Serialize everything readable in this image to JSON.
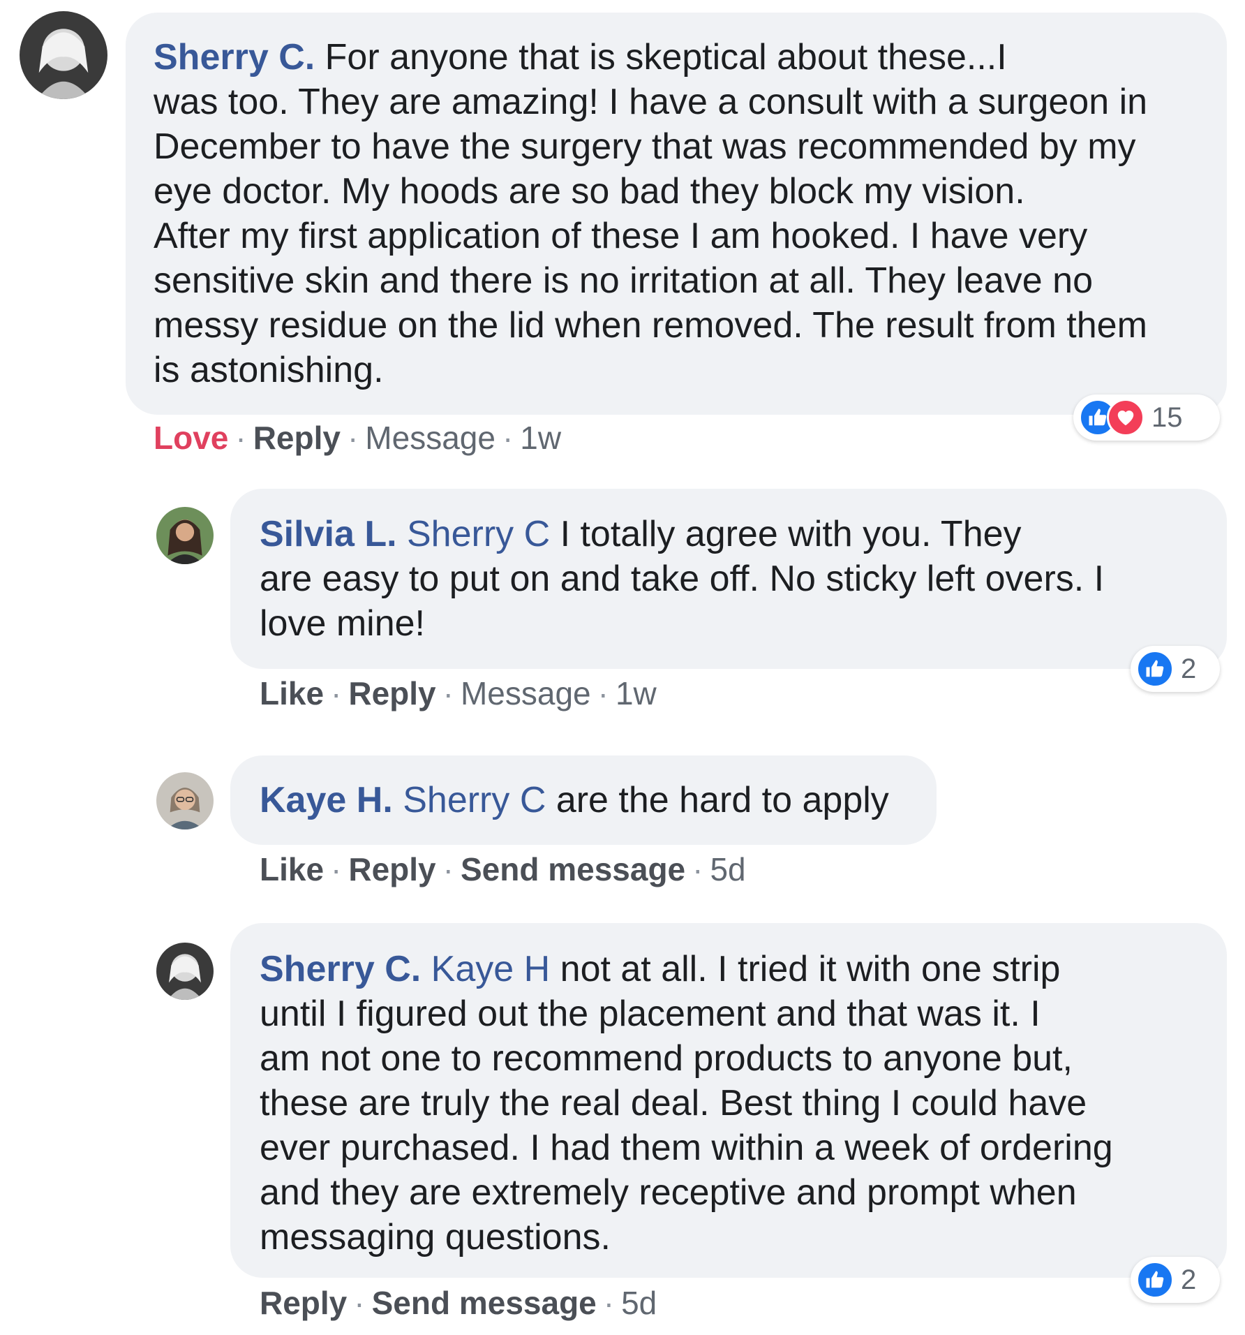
{
  "comments": [
    {
      "author": "Sherry C.",
      "mention": "",
      "text": " For anyone that is skeptical about these...I\nwas too. They are amazing! I have a consult with a surgeon in\nDecember to have the surgery that was recommended by my\neye doctor. My hoods are so bad they block my vision.\nAfter my first application of these I am hooked. I have very\nsensitive skin and there is no irritation at all. They leave no\nmessy residue on the lid when removed. The result from them\nis astonishing.",
      "actions": [
        "Love",
        "Reply",
        "Message"
      ],
      "time": "1w",
      "reaction_icons": [
        "like-icon",
        "love-icon"
      ],
      "reaction_count": "15"
    },
    {
      "author": "Silvia L.",
      "mention": " Sherry C",
      "text": " I totally agree with you. They\nare easy to put on and take off. No sticky left overs. I\nlove mine!",
      "actions": [
        "Like",
        "Reply",
        "Message"
      ],
      "time": "1w",
      "reaction_icons": [
        "like-icon"
      ],
      "reaction_count": "2"
    },
    {
      "author": "Kaye H.",
      "mention": " Sherry C",
      "text": " are the hard to apply",
      "actions": [
        "Like",
        "Reply",
        "Send message"
      ],
      "time": "5d",
      "reaction_icons": [],
      "reaction_count": ""
    },
    {
      "author": "Sherry C.",
      "mention": " Kaye H",
      "text": " not at all. I tried it with one strip\nuntil I figured out the placement and that was it. I\nam not one to recommend products to anyone but,\nthese are truly the real deal. Best thing I could have\never purchased. I had them within a week of ordering\nand they are extremely receptive and prompt when\nmessaging questions.",
      "actions": [
        "Reply",
        "Send message"
      ],
      "time": "5d",
      "reaction_icons": [
        "like-icon"
      ],
      "reaction_count": "2"
    }
  ],
  "colors": {
    "bubble": "#f0f2f5",
    "author_link": "#385898",
    "love": "#e0405e",
    "like_blue": "#1877f2",
    "love_red": "#f33e58"
  }
}
